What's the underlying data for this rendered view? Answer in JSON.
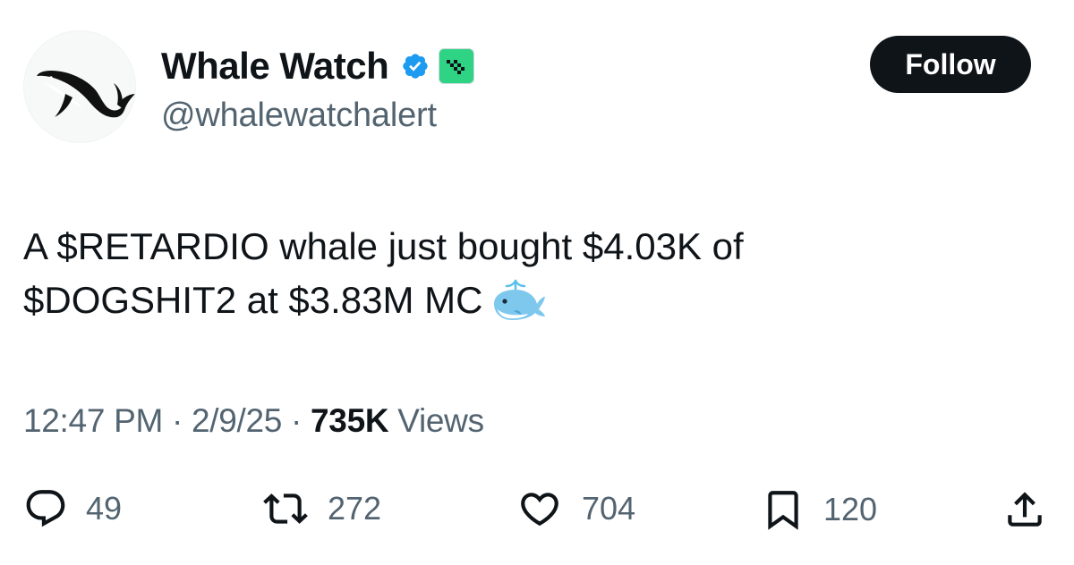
{
  "author": {
    "display_name": "Whale Watch",
    "handle": "@whalewatchalert",
    "verified_icon": "verified-badge-icon",
    "affiliation_icon": "checkered-flag-icon",
    "avatar_icon": "whale-icon"
  },
  "follow_label": "Follow",
  "tweet": {
    "line1": "A $RETARDIO whale just bought $4.03K of",
    "line2": "$DOGSHIT2 at $3.83M MC",
    "emoji": "spouting-whale-icon"
  },
  "meta": {
    "time": "12:47 PM",
    "sep1": " · ",
    "date": "2/9/25",
    "sep2": " · ",
    "views_count": "735K",
    "views_label": " Views"
  },
  "actions": {
    "replies": "49",
    "reposts": "272",
    "likes": "704",
    "bookmarks": "120"
  },
  "colors": {
    "text": "#0f1419",
    "secondary": "#536471",
    "verified": "#1d9bf0",
    "affiliation_badge": "#2ed484",
    "button": "#0f1419"
  }
}
